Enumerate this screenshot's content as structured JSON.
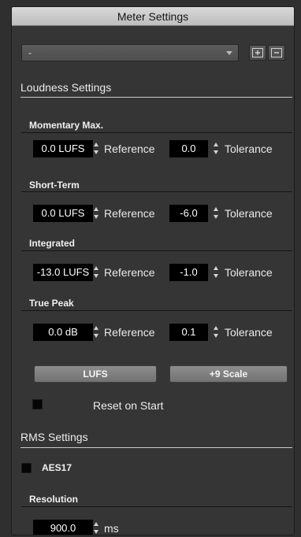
{
  "window": {
    "title": "Meter Settings"
  },
  "preset": {
    "value": "-"
  },
  "loudness": {
    "title": "Loudness Settings",
    "groups": [
      {
        "name": "Momentary Max.",
        "reference": "0.0 LUFS",
        "tolerance": "0.0"
      },
      {
        "name": "Short-Term",
        "reference": "0.0 LUFS",
        "tolerance": "-6.0"
      },
      {
        "name": "Integrated",
        "reference": "-13.0 LUFS",
        "tolerance": "-1.0"
      },
      {
        "name": "True Peak",
        "reference": "0.0 dB",
        "tolerance": "0.1"
      }
    ],
    "reference_label": "Reference",
    "tolerance_label": "Tolerance",
    "lufs_button": "LUFS",
    "scale_button": "+9 Scale",
    "reset_label": "Reset on Start",
    "reset_checked": false
  },
  "rms": {
    "title": "RMS Settings",
    "aes17_label": "AES17",
    "aes17_checked": false,
    "resolution_title": "Resolution",
    "resolution_value": "900.0",
    "resolution_unit": "ms"
  },
  "icons": {
    "add_preset": "add-preset-icon",
    "remove_preset": "remove-preset-icon",
    "dropdown": "chevron-down-icon",
    "spin": "spin-arrows-icon"
  }
}
